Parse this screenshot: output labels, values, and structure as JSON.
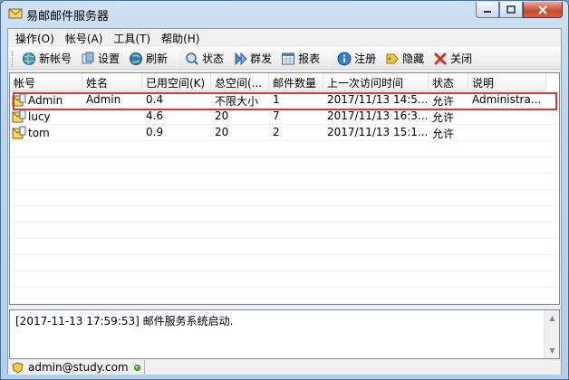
{
  "window": {
    "title": "易邮邮件服务器"
  },
  "menu": [
    {
      "label": "操作(O)"
    },
    {
      "label": "帐号(A)"
    },
    {
      "label": "工具(T)"
    },
    {
      "label": "帮助(H)"
    }
  ],
  "toolbar": {
    "new_account": "新帐号",
    "settings": "设置",
    "refresh": "刷新",
    "status": "状态",
    "broadcast": "群发",
    "report": "报表",
    "register": "注册",
    "hide": "隐藏",
    "close": "关闭"
  },
  "table": {
    "columns": [
      "帐号",
      "姓名",
      "已用空间(K)",
      "总空间(...",
      "邮件数量",
      "上一次访问时间",
      "状态",
      "说明"
    ],
    "rows": [
      [
        "Admin",
        "Admin",
        "0.4",
        "不限大小",
        "1",
        "2017/11/13 14:5...",
        "允许",
        "Administra..."
      ],
      [
        "lucy",
        "",
        "4.6",
        "20",
        "7",
        "2017/11/13 16:3...",
        "允许",
        ""
      ],
      [
        "tom",
        "",
        "0.9",
        "20",
        "2",
        "2017/11/13 15:1...",
        "允许",
        ""
      ]
    ]
  },
  "log": {
    "line": "[2017-11-13 17:59:53] 邮件服务系统启动."
  },
  "status": {
    "user": "admin@study.com"
  },
  "colors": {
    "highlight": "#d9383a",
    "titlebar": "#bcd5ee",
    "led": "#27a016"
  }
}
